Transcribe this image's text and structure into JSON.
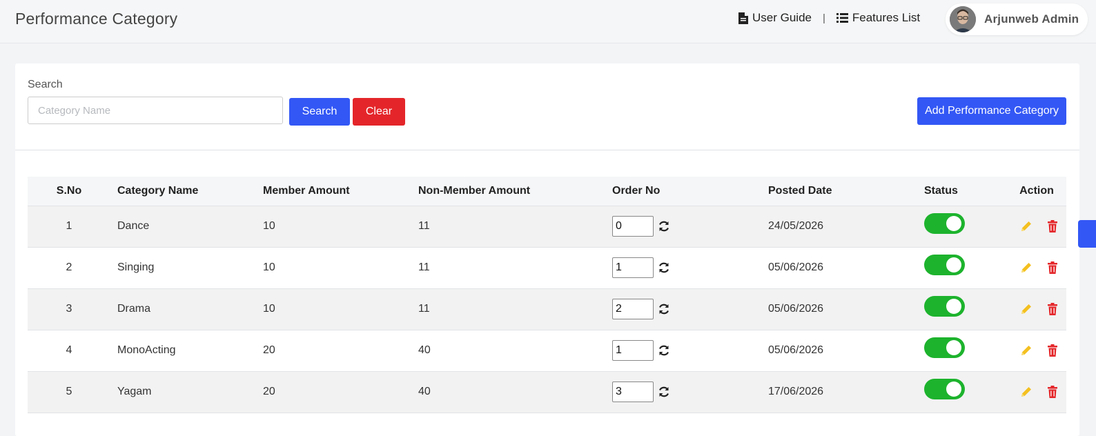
{
  "header": {
    "title": "Performance Category",
    "user_guide": "User Guide",
    "separator": "|",
    "features_list": "Features List",
    "user_name": "Arjunweb Admin"
  },
  "search": {
    "label": "Search",
    "placeholder": "Category Name",
    "search_button": "Search",
    "clear_button": "Clear",
    "add_button": "Add Performance Category"
  },
  "table": {
    "headers": {
      "sno": "S.No",
      "category": "Category Name",
      "member": "Member Amount",
      "nonmember": "Non-Member Amount",
      "order": "Order No",
      "date": "Posted Date",
      "status": "Status",
      "action": "Action"
    },
    "rows": [
      {
        "sno": "1",
        "category": "Dance",
        "member": "10",
        "nonmember": "11",
        "order": "0",
        "date": "24/05/2026",
        "status": "on"
      },
      {
        "sno": "2",
        "category": "Singing",
        "member": "10",
        "nonmember": "11",
        "order": "1",
        "date": "05/06/2026",
        "status": "on"
      },
      {
        "sno": "3",
        "category": "Drama",
        "member": "10",
        "nonmember": "11",
        "order": "2",
        "date": "05/06/2026",
        "status": "on"
      },
      {
        "sno": "4",
        "category": "MonoActing",
        "member": "20",
        "nonmember": "40",
        "order": "1",
        "date": "05/06/2026",
        "status": "on"
      },
      {
        "sno": "5",
        "category": "Yagam",
        "member": "20",
        "nonmember": "40",
        "order": "3",
        "date": "17/06/2026",
        "status": "on"
      }
    ]
  },
  "icons": {
    "user_guide": "file-icon",
    "features_list": "list-icon",
    "order_refresh": "refresh-icon",
    "edit": "pencil-icon",
    "delete": "trash-icon"
  },
  "colors": {
    "primary": "#3357f5",
    "danger": "#e4262a",
    "toggle_on": "#1db32d",
    "edit_icon": "#f4c020",
    "delete_icon": "#e4262a"
  }
}
